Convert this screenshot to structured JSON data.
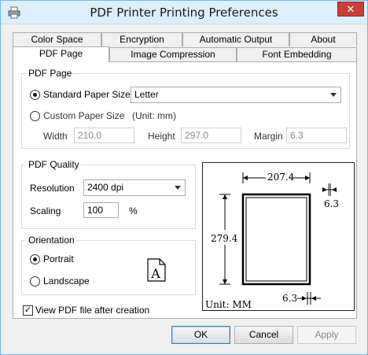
{
  "window": {
    "title": "PDF Printer Printing Preferences",
    "close_glyph": "✕",
    "title_icon": "printer-icon"
  },
  "tabs": {
    "back_row": [
      "Color Space",
      "Encryption",
      "Automatic Output",
      "About"
    ],
    "front_row": [
      "PDF Page",
      "Image Compression",
      "Font Embedding"
    ],
    "active": "PDF Page"
  },
  "pdf_page": {
    "group_title": "PDF Page",
    "standard_label": "Standard Paper Size",
    "standard_selected": true,
    "paper_size_value": "Letter",
    "custom_label": "Custom Paper Size",
    "custom_selected": false,
    "unit_note": "(Unit: mm)",
    "width_label": "Width",
    "width_value": "210.0",
    "height_label": "Height",
    "height_value": "297.0",
    "margin_label": "Margin",
    "margin_value": "6.3"
  },
  "pdf_quality": {
    "group_title": "PDF Quality",
    "resolution_label": "Resolution",
    "resolution_value": "2400 dpi",
    "scaling_label": "Scaling",
    "scaling_value": "100",
    "scaling_unit": "%"
  },
  "orientation": {
    "group_title": "Orientation",
    "portrait_label": "Portrait",
    "portrait_selected": true,
    "landscape_label": "Landscape",
    "landscape_selected": false,
    "preview_glyph": "A"
  },
  "view_after": {
    "label": "View PDF file after creation",
    "checked": true,
    "check_glyph": "✓"
  },
  "preview": {
    "width_dim": "207.4",
    "height_dim": "279.4",
    "margin_right": "6.3",
    "margin_bottom": "6.3",
    "unit": "Unit: MM"
  },
  "buttons": {
    "ok": "OK",
    "cancel": "Cancel",
    "apply": "Apply"
  }
}
